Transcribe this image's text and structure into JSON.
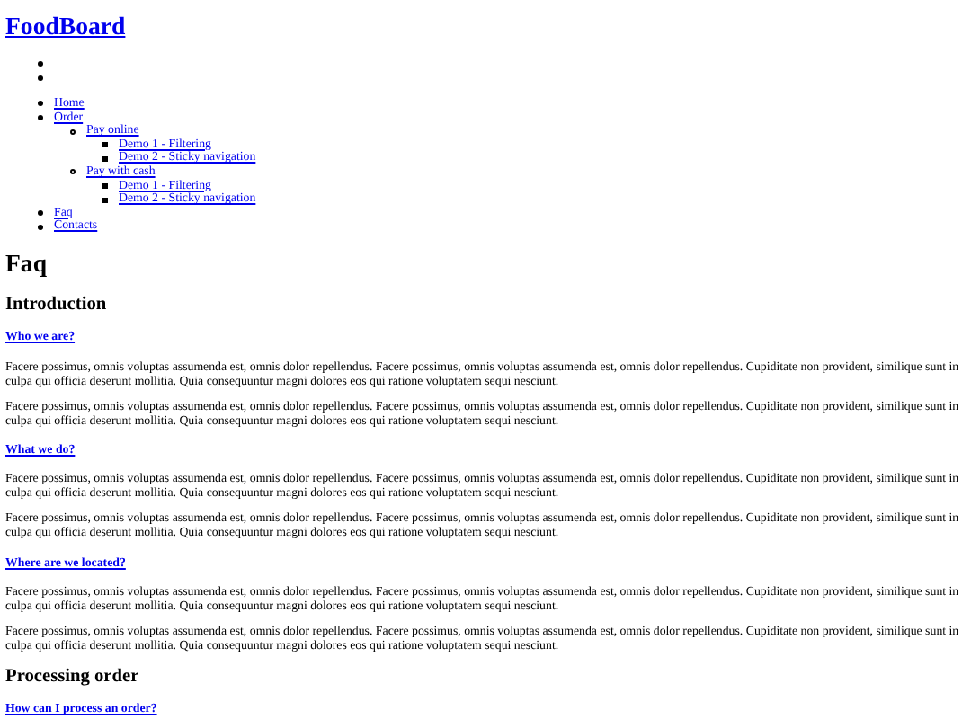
{
  "site_title": "FoodBoard",
  "nav": [
    {
      "label": "Home"
    },
    {
      "label": "Order",
      "children": [
        {
          "label": "Pay online",
          "children": [
            {
              "label": "Demo 1 - Filtering"
            },
            {
              "label": "Demo 2 - Sticky navigation"
            }
          ]
        },
        {
          "label": "Pay with cash",
          "children": [
            {
              "label": "Demo 1 - Filtering"
            },
            {
              "label": "Demo 2 - Sticky navigation"
            }
          ]
        }
      ]
    },
    {
      "label": "Faq"
    },
    {
      "label": "Contacts"
    }
  ],
  "page_title": "Faq",
  "sections": [
    {
      "heading": "Introduction",
      "questions": [
        {
          "question": "Who we are?",
          "paragraphs": [
            "Facere possimus, omnis voluptas assumenda est, omnis dolor repellendus. Facere possimus, omnis voluptas assumenda est, omnis dolor repellendus. Cupiditate non provident, similique sunt in culpa qui officia deserunt mollitia. Quia consequuntur magni dolores eos qui ratione voluptatem sequi nesciunt.",
            "Facere possimus, omnis voluptas assumenda est, omnis dolor repellendus. Facere possimus, omnis voluptas assumenda est, omnis dolor repellendus. Cupiditate non provident, similique sunt in culpa qui officia deserunt mollitia. Quia consequuntur magni dolores eos qui ratione voluptatem sequi nesciunt."
          ]
        },
        {
          "question": "What we do?",
          "paragraphs": [
            "Facere possimus, omnis voluptas assumenda est, omnis dolor repellendus. Facere possimus, omnis voluptas assumenda est, omnis dolor repellendus. Cupiditate non provident, similique sunt in culpa qui officia deserunt mollitia. Quia consequuntur magni dolores eos qui ratione voluptatem sequi nesciunt.",
            "Facere possimus, omnis voluptas assumenda est, omnis dolor repellendus. Facere possimus, omnis voluptas assumenda est, omnis dolor repellendus. Cupiditate non provident, similique sunt in culpa qui officia deserunt mollitia. Quia consequuntur magni dolores eos qui ratione voluptatem sequi nesciunt."
          ]
        },
        {
          "question": "Where are we located?",
          "paragraphs": [
            "Facere possimus, omnis voluptas assumenda est, omnis dolor repellendus. Facere possimus, omnis voluptas assumenda est, omnis dolor repellendus. Cupiditate non provident, similique sunt in culpa qui officia deserunt mollitia. Quia consequuntur magni dolores eos qui ratione voluptatem sequi nesciunt.",
            "Facere possimus, omnis voluptas assumenda est, omnis dolor repellendus. Facere possimus, omnis voluptas assumenda est, omnis dolor repellendus. Cupiditate non provident, similique sunt in culpa qui officia deserunt mollitia. Quia consequuntur magni dolores eos qui ratione voluptatem sequi nesciunt."
          ]
        }
      ]
    },
    {
      "heading": "Processing order",
      "questions": [
        {
          "question": "How can I process an order?"
        }
      ]
    }
  ]
}
